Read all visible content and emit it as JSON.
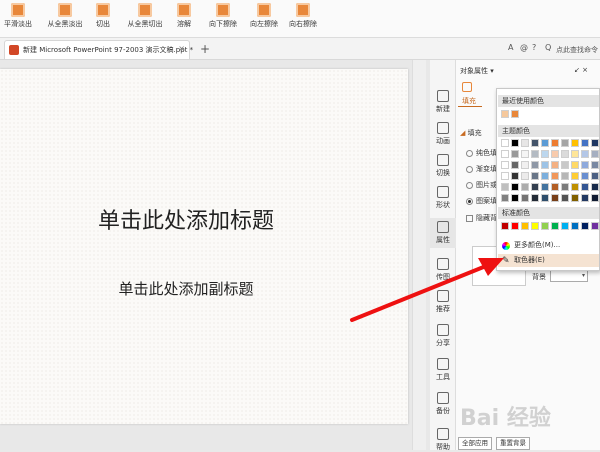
{
  "ribbon": {
    "buttons": [
      {
        "label": "平滑淡出"
      },
      {
        "label": "从全黑淡出"
      },
      {
        "label": "切出"
      },
      {
        "label": "从全黑切出"
      },
      {
        "label": "溶解"
      },
      {
        "label": "向下擦除"
      },
      {
        "label": "向左擦除"
      },
      {
        "label": "向右擦除"
      }
    ]
  },
  "tabbar": {
    "doc_tab": "新建 Microsoft PowerPoint 97-2003 演示文稿.ppt *",
    "close": "×",
    "add": "+",
    "right_icons": [
      "A",
      "@",
      "?",
      "Q"
    ],
    "search_text": "点此查找命令"
  },
  "slide": {
    "title": "单击此处添加标题",
    "subtitle": "单击此处添加副标题"
  },
  "vtoolbar": {
    "items": [
      {
        "label": "新建",
        "icon": "new-slide-icon"
      },
      {
        "label": "动画",
        "icon": "animation-icon"
      },
      {
        "label": "切换",
        "icon": "transition-icon"
      },
      {
        "label": "形状",
        "icon": "shape-icon"
      },
      {
        "label": "属性",
        "icon": "property-icon"
      },
      {
        "label": "传图",
        "icon": "picture-icon"
      },
      {
        "label": "推荐",
        "icon": "recommend-icon"
      },
      {
        "label": "分享",
        "icon": "share-icon"
      },
      {
        "label": "工具",
        "icon": "tools-icon"
      },
      {
        "label": "备份",
        "icon": "backup-icon"
      },
      {
        "label": "帮助",
        "icon": "help-icon"
      }
    ]
  },
  "property_panel": {
    "title": "对象属性 ▾",
    "tab_fill": "填充",
    "section_fill": "填充",
    "options": [
      "纯色填",
      "渐变填",
      "图片或",
      "图案填"
    ],
    "hide_bg": "隐藏背",
    "bg_label": "背景",
    "apply_all": "全部应用",
    "reset_bg": "重置背景",
    "top_icons": "↙ ×"
  },
  "color_popup": {
    "recent": "最近使用颜色",
    "theme": "主题颜色",
    "standard": "标准颜色",
    "more_colors": "更多颜色(M)...",
    "eyedropper": "取色器(E)",
    "recent_colors": [
      "#f5c89c",
      "#e8873a"
    ],
    "theme_top": [
      "#ffffff",
      "#000000",
      "#e7e6e6",
      "#44546a",
      "#5b9bd5",
      "#ed7d31",
      "#a5a5a5",
      "#ffc000",
      "#4472c4",
      "#1f3864"
    ],
    "standard_colors": [
      "#c00000",
      "#ff0000",
      "#ffc000",
      "#ffff00",
      "#92d050",
      "#00b050",
      "#00b0f0",
      "#0070c0",
      "#002060",
      "#7030a0"
    ]
  },
  "watermark": "Bai 经验"
}
